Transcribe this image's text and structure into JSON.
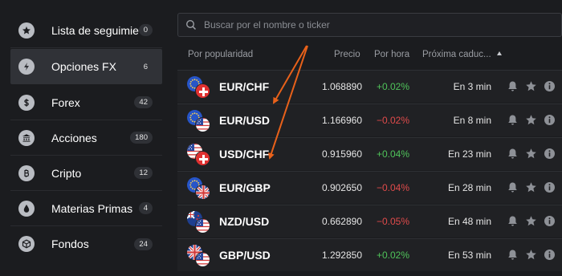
{
  "sidebar": {
    "items": [
      {
        "label": "Lista de seguimiento",
        "badge": "0",
        "icon": "star-icon"
      },
      {
        "label": "Opciones FX",
        "badge": "6",
        "icon": "bolt-icon"
      },
      {
        "label": "Forex",
        "badge": "42",
        "icon": "dollar-icon"
      },
      {
        "label": "Acciones",
        "badge": "180",
        "icon": "bank-icon"
      },
      {
        "label": "Cripto",
        "badge": "12",
        "icon": "bitcoin-icon"
      },
      {
        "label": "Materias Primas",
        "badge": "4",
        "icon": "drop-icon"
      },
      {
        "label": "Fondos",
        "badge": "24",
        "icon": "cube-icon"
      }
    ]
  },
  "search": {
    "placeholder": "Buscar por el nombre o ticker"
  },
  "table": {
    "headers": {
      "popularity": "Por popularidad",
      "price": "Precio",
      "per_hour": "Por hora",
      "expiry": "Próxima caduc..."
    },
    "rows": [
      {
        "pair": "EUR/CHF",
        "price": "1.068890",
        "change": "+0.02%",
        "expiry": "En 3 min",
        "base": "eu",
        "quote": "ch"
      },
      {
        "pair": "EUR/USD",
        "price": "1.166960",
        "change": "−0.02%",
        "expiry": "En 8 min",
        "base": "eu",
        "quote": "us"
      },
      {
        "pair": "USD/CHF",
        "price": "0.915960",
        "change": "+0.04%",
        "expiry": "En 23 min",
        "base": "us",
        "quote": "ch"
      },
      {
        "pair": "EUR/GBP",
        "price": "0.902650",
        "change": "−0.04%",
        "expiry": "En 28 min",
        "base": "eu",
        "quote": "gb"
      },
      {
        "pair": "NZD/USD",
        "price": "0.662890",
        "change": "−0.05%",
        "expiry": "En 48 min",
        "base": "nz",
        "quote": "us"
      },
      {
        "pair": "GBP/USD",
        "price": "1.292850",
        "change": "+0.02%",
        "expiry": "En 53 min",
        "base": "gb",
        "quote": "us"
      }
    ]
  },
  "colors": {
    "up": "#4fc35a",
    "down": "#e04b4b",
    "annotation_arrow": "#e8611a",
    "active_item_bg": "#303237"
  }
}
